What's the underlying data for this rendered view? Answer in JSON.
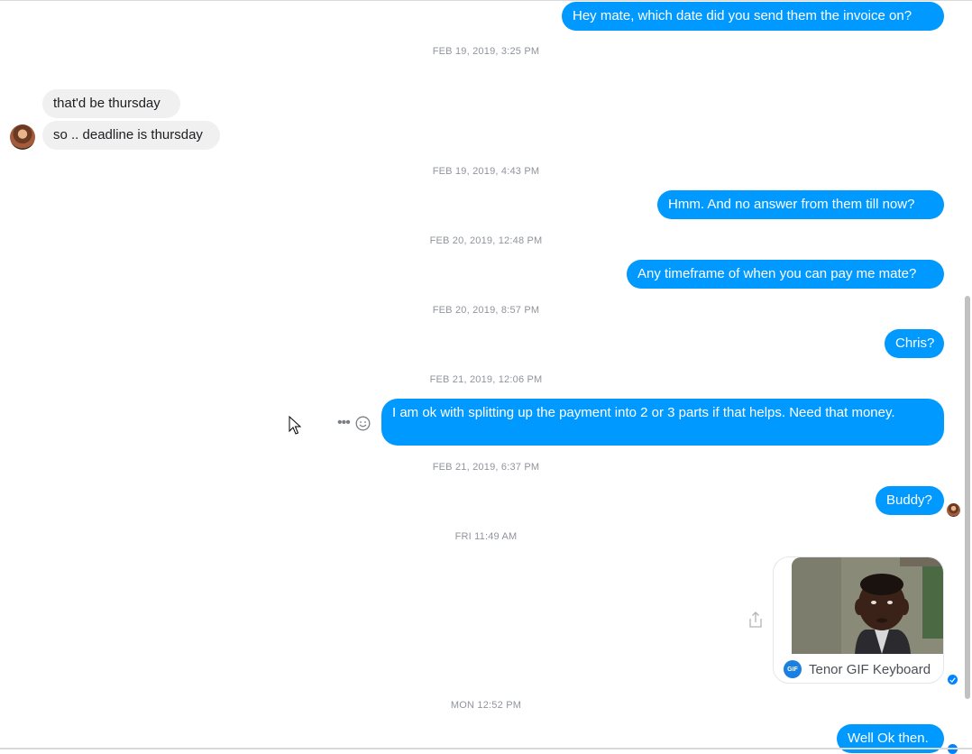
{
  "messages": [
    {
      "text": "Hey mate, which date did you send them the invoice on?"
    },
    {
      "text": "that'd be thursday"
    },
    {
      "text": "so .. deadline is thursday"
    },
    {
      "text": "Hmm. And no answer from them till now?"
    },
    {
      "text": "Any timeframe of when you can pay me mate?"
    },
    {
      "text": "Chris?"
    },
    {
      "text": "I am ok with splitting up the payment into 2 or 3 parts if that helps. Need that money."
    },
    {
      "text": "Buddy?"
    },
    {
      "text": "Well Ok then."
    }
  ],
  "timestamps": [
    "FEB 19, 2019, 3:25 PM",
    "FEB 19, 2019, 4:43 PM",
    "FEB 20, 2019, 12:48 PM",
    "FEB 20, 2019, 8:57 PM",
    "FEB 21, 2019, 12:06 PM",
    "FEB 21, 2019, 6:37 PM",
    "FRI 11:49 AM",
    "MON 12:52 PM"
  ],
  "gif": {
    "badge": "GIF",
    "label": "Tenor GIF Keyboard",
    "icon": "tenor-gif-icon"
  },
  "icons": {
    "more": "more-dots-icon",
    "react": "emoji-react-icon",
    "share": "share-icon",
    "seen": "seen-check-icon",
    "cursor": "mouse-cursor-icon"
  },
  "colors": {
    "outgoing_bubble": "#0099ff",
    "incoming_bubble": "#f1f0f0",
    "timestamp_text": "#90949c",
    "seen_indicator": "#0084ff"
  }
}
